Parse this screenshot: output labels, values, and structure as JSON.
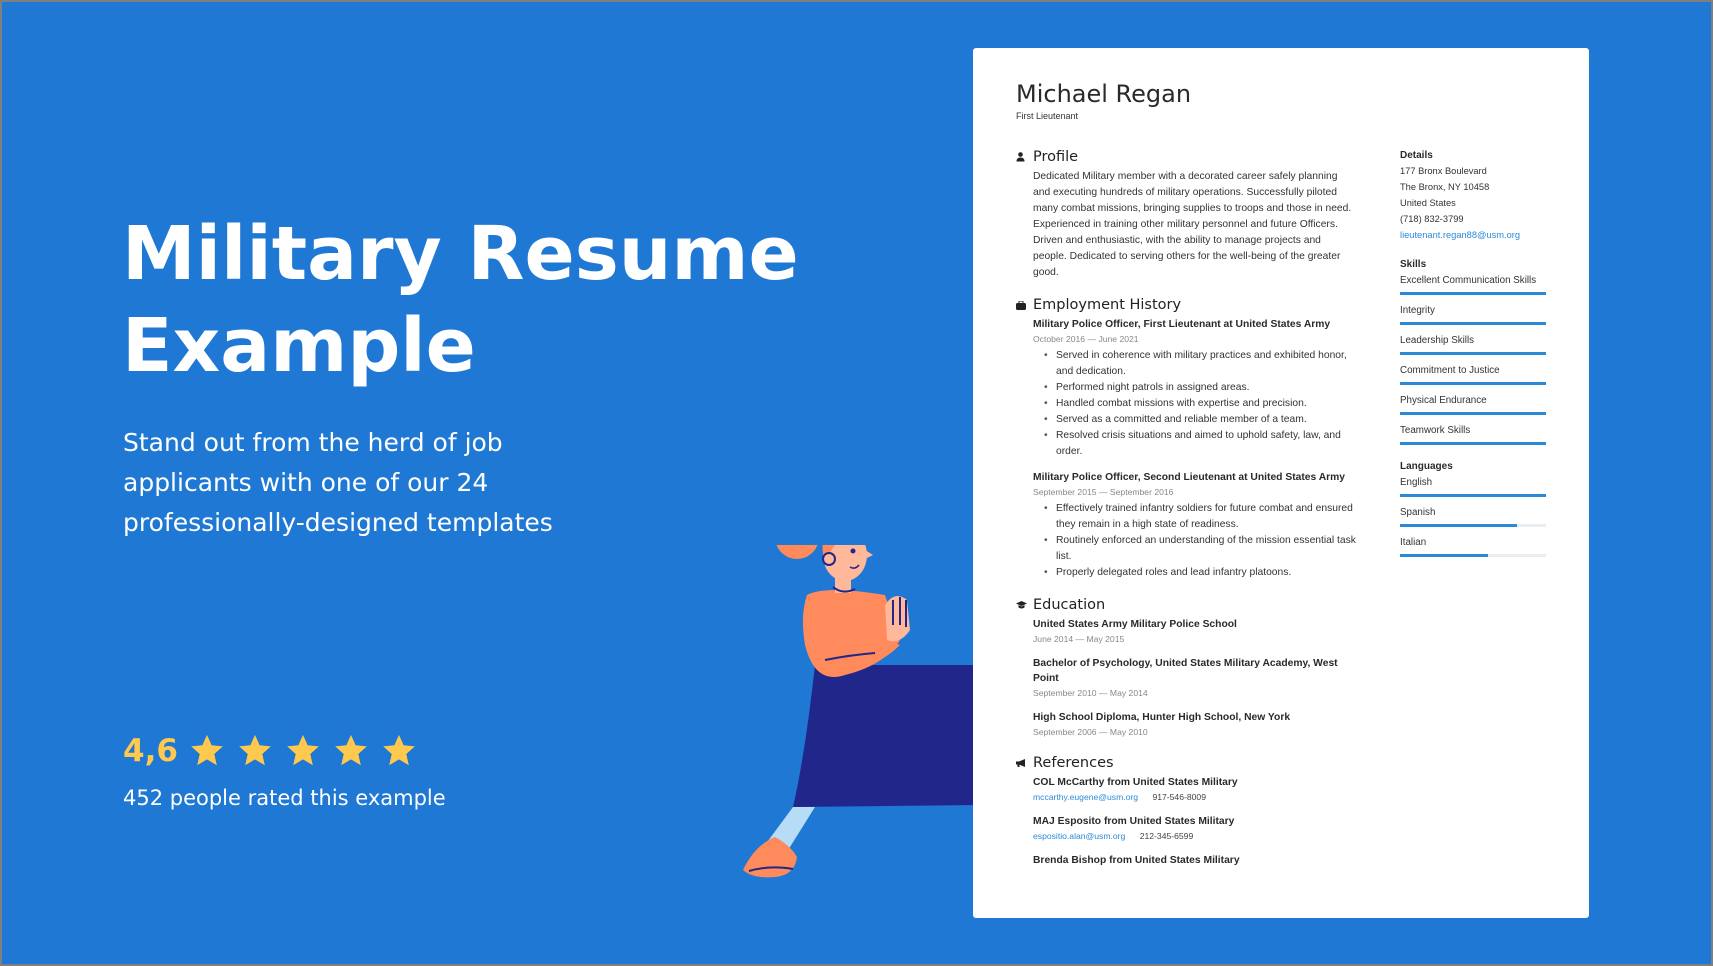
{
  "hero": {
    "title_line1": "Military Resume",
    "title_line2": "Example",
    "subtitle": "Stand out from the herd of job applicants with one of our 24 professionally-designed templates",
    "rating_value": "4,6",
    "star_count": 5,
    "rated_count_text": "452 people rated this example"
  },
  "colors": {
    "background": "#1e78d4",
    "star": "#ffc94d",
    "accent_link": "#2b8ad8",
    "card": "#ffffff"
  },
  "resume": {
    "name": "Michael Regan",
    "job_title": "First Lieutenant",
    "profile": {
      "title": "Profile",
      "icon": "person-icon",
      "text": "Dedicated Military member with a decorated career safely planning and executing hundreds of military operations. Successfully piloted many combat missions, bringing supplies to troops and those in need. Experienced in training other military personnel and future Officers. Driven and enthusiastic, with the ability to manage projects and people. Dedicated to serving others for the well-being of the greater good."
    },
    "employment": {
      "title": "Employment History",
      "icon": "briefcase-icon",
      "jobs": [
        {
          "title": "Military Police Officer, First Lieutenant at United States Army",
          "dates": "October 2016 — June 2021",
          "bullets": [
            "Served in coherence with military practices and exhibited honor, and dedication.",
            "Performed night patrols in assigned areas.",
            "Handled combat missions with expertise and precision.",
            "Served as a committed and reliable member of a team.",
            "Resolved crisis situations and aimed to uphold safety, law, and order."
          ]
        },
        {
          "title": "Military Police Officer, Second Lieutenant at United States Army",
          "dates": "September 2015 — September 2016",
          "bullets": [
            "Effectively trained infantry soldiers for future combat and ensured they remain in a high state of readiness.",
            "Routinely enforced an understanding of the mission essential task list.",
            "Properly delegated roles and lead infantry platoons."
          ]
        }
      ]
    },
    "education": {
      "title": "Education",
      "icon": "graduation-cap-icon",
      "items": [
        {
          "title": "United States Army Military Police School",
          "dates": "June 2014 — May 2015"
        },
        {
          "title": "Bachelor of Psychology, United States Military Academy,  West Point",
          "dates": "September 2010 — May 2014"
        },
        {
          "title": "High School Diploma, Hunter High School, New York",
          "dates": "September 2006 — May 2010"
        }
      ]
    },
    "references": {
      "title": "References",
      "icon": "megaphone-icon",
      "items": [
        {
          "name": "COL McCarthy from United States Military",
          "email": "mccarthy.eugene@usm.org",
          "phone": "917-546-8009"
        },
        {
          "name": "MAJ Esposito from United States Military",
          "email": "espositio.alan@usm.org",
          "phone": "212-345-6599"
        },
        {
          "name": "Brenda Bishop from United States Military"
        }
      ]
    },
    "details": {
      "title": "Details",
      "lines": [
        "177 Bronx Boulevard",
        "The Bronx, NY 10458",
        "United States",
        "(718) 832-3799"
      ],
      "email": "lieutenant.regan88@usm.org"
    },
    "skills": {
      "title": "Skills",
      "items": [
        {
          "label": "Excellent Communication Skills",
          "level": 1.0
        },
        {
          "label": "Integrity",
          "level": 1.0
        },
        {
          "label": "Leadership Skills",
          "level": 1.0
        },
        {
          "label": "Commitment to Justice",
          "level": 1.0
        },
        {
          "label": "Physical Endurance",
          "level": 1.0
        },
        {
          "label": "Teamwork Skills",
          "level": 1.0
        }
      ]
    },
    "languages": {
      "title": "Languages",
      "items": [
        {
          "label": "English",
          "level": 1.0
        },
        {
          "label": "Spanish",
          "level": 0.8
        },
        {
          "label": "Italian",
          "level": 0.6
        }
      ]
    }
  }
}
